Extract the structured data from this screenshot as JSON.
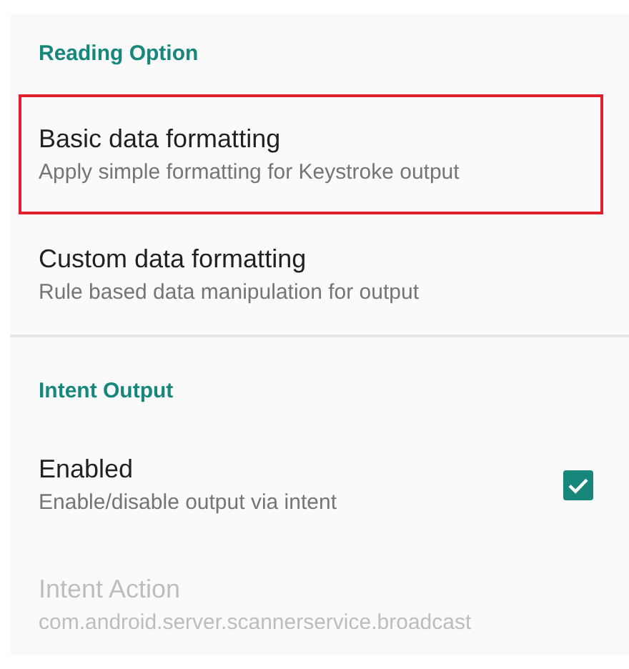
{
  "sections": [
    {
      "title": "Reading Option",
      "items": [
        {
          "kind": "plain",
          "title": "Basic data formatting",
          "summary": "Apply simple formatting for Keystroke output",
          "highlighted": true,
          "disabled": false
        },
        {
          "kind": "plain",
          "title": "Custom data formatting",
          "summary": "Rule based data manipulation for output",
          "highlighted": false,
          "disabled": false
        }
      ]
    },
    {
      "title": "Intent Output",
      "items": [
        {
          "kind": "checkbox",
          "title": "Enabled",
          "summary": "Enable/disable output via intent",
          "checked": true,
          "highlighted": false,
          "disabled": false
        },
        {
          "kind": "plain",
          "title": "Intent Action",
          "summary": "com.android.server.scannerservice.broadcast",
          "highlighted": false,
          "disabled": true
        }
      ]
    }
  ]
}
